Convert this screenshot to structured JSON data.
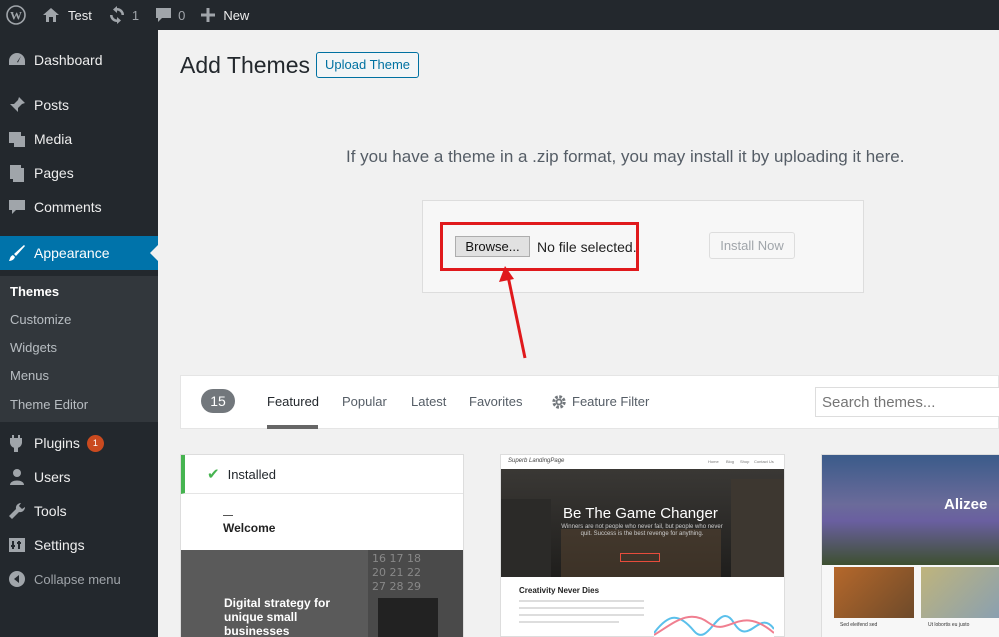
{
  "adminbar": {
    "site_name": "Test",
    "updates_count": "1",
    "comments_count": "0",
    "new_label": "New"
  },
  "sidebar": {
    "items": [
      {
        "label": "Dashboard",
        "icon": "dashboard-icon"
      },
      {
        "label": "Posts",
        "icon": "pin-icon"
      },
      {
        "label": "Media",
        "icon": "media-icon"
      },
      {
        "label": "Pages",
        "icon": "pages-icon"
      },
      {
        "label": "Comments",
        "icon": "comment-icon"
      },
      {
        "label": "Appearance",
        "icon": "brush-icon"
      },
      {
        "label": "Plugins",
        "icon": "plug-icon",
        "badge": "1"
      },
      {
        "label": "Users",
        "icon": "users-icon"
      },
      {
        "label": "Tools",
        "icon": "wrench-icon"
      },
      {
        "label": "Settings",
        "icon": "settings-icon"
      }
    ],
    "submenu": [
      "Themes",
      "Customize",
      "Widgets",
      "Menus",
      "Theme Editor"
    ],
    "collapse_label": "Collapse menu"
  },
  "main": {
    "title": "Add Themes",
    "upload_button": "Upload Theme",
    "upload_help": "If you have a theme in a .zip format, you may install it by uploading it here.",
    "browse_button": "Browse...",
    "file_status": "No file selected.",
    "install_button": "Install Now"
  },
  "filter": {
    "count": "15",
    "tabs": [
      "Featured",
      "Popular",
      "Latest",
      "Favorites"
    ],
    "feature_filter": "Feature Filter",
    "search_placeholder": "Search themes..."
  },
  "themes": {
    "card1": {
      "installed_label": "Installed",
      "welcome": "Welcome",
      "tagline": "Digital strategy for unique small businesses"
    },
    "card2": {
      "brand": "Superb LandingPage",
      "nav": [
        "Home",
        "Blog",
        "Shop",
        "Contact Us"
      ],
      "hero_title": "Be The Game Changer",
      "hero_sub": "Winners are not people who never fail, but people who never quit. Success is the best revenge for anything.",
      "section_title": "Creativity Never Dies"
    },
    "card3": {
      "title": "Alizee",
      "caption1": "Sed eleifend sed",
      "caption2": "Ut lobortis eu justo"
    }
  },
  "colors": {
    "accent": "#0073aa",
    "sidebar": "#23282d",
    "highlight": "#e0191c",
    "installed": "#46b450"
  }
}
